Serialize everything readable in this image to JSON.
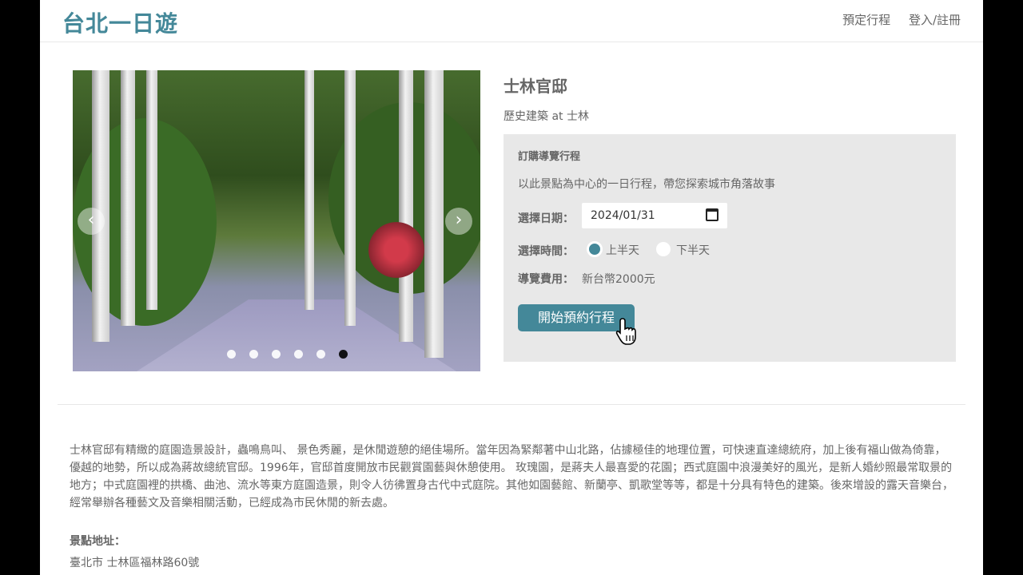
{
  "header": {
    "brand": "台北一日遊",
    "nav": {
      "booking_link": "預定行程",
      "login_link": "登入/註冊"
    }
  },
  "attraction": {
    "name": "士林官邸",
    "category_line": "歷史建築 at 士林"
  },
  "carousel": {
    "prev_icon": "chevron-left-icon",
    "next_icon": "chevron-right-icon",
    "dot_count": 6,
    "active_dot_index": 5
  },
  "booking": {
    "title": "訂購導覽行程",
    "description": "以此景點為中心的一日行程，帶您探索城市角落故事",
    "date_label": "選擇日期：",
    "date_value": "2024/01/31",
    "time_label": "選擇時間：",
    "time_options": [
      {
        "label": "上半天",
        "selected": true
      },
      {
        "label": "下半天",
        "selected": false
      }
    ],
    "fee_label": "導覽費用：",
    "fee_value": "新台幣2000元",
    "submit_label": "開始預約行程",
    "accent_color": "#448899"
  },
  "info": {
    "description": "士林官邸有精緻的庭園造景設計，蟲鳴鳥叫、 景色秀麗，是休閒遊憩的絕佳場所。當年因為緊鄰著中山北路，佔據極佳的地理位置，可快速直達總統府，加上後有福山做為倚靠，優越的地勢，所以成為蔣故總統官邸。1996年，官邸首度開放市民觀賞園藝與休憩使用。 玫瑰園，是蔣夫人最喜愛的花園；西式庭園中浪漫美好的風光，是新人婚紗照最常取景的地方；中式庭園裡的拱橋、曲池、流水等東方庭園造景，則令人彷彿置身古代中式庭院。其他如園藝館、新蘭亭、凱歌堂等等，都是十分具有特色的建築。後來增設的露天音樂台，經常舉辦各種藝文及音樂相關活動，已經成為市民休閒的新去處。",
    "address_label": "景點地址：",
    "address": "臺北市 士林區福林路60號"
  }
}
